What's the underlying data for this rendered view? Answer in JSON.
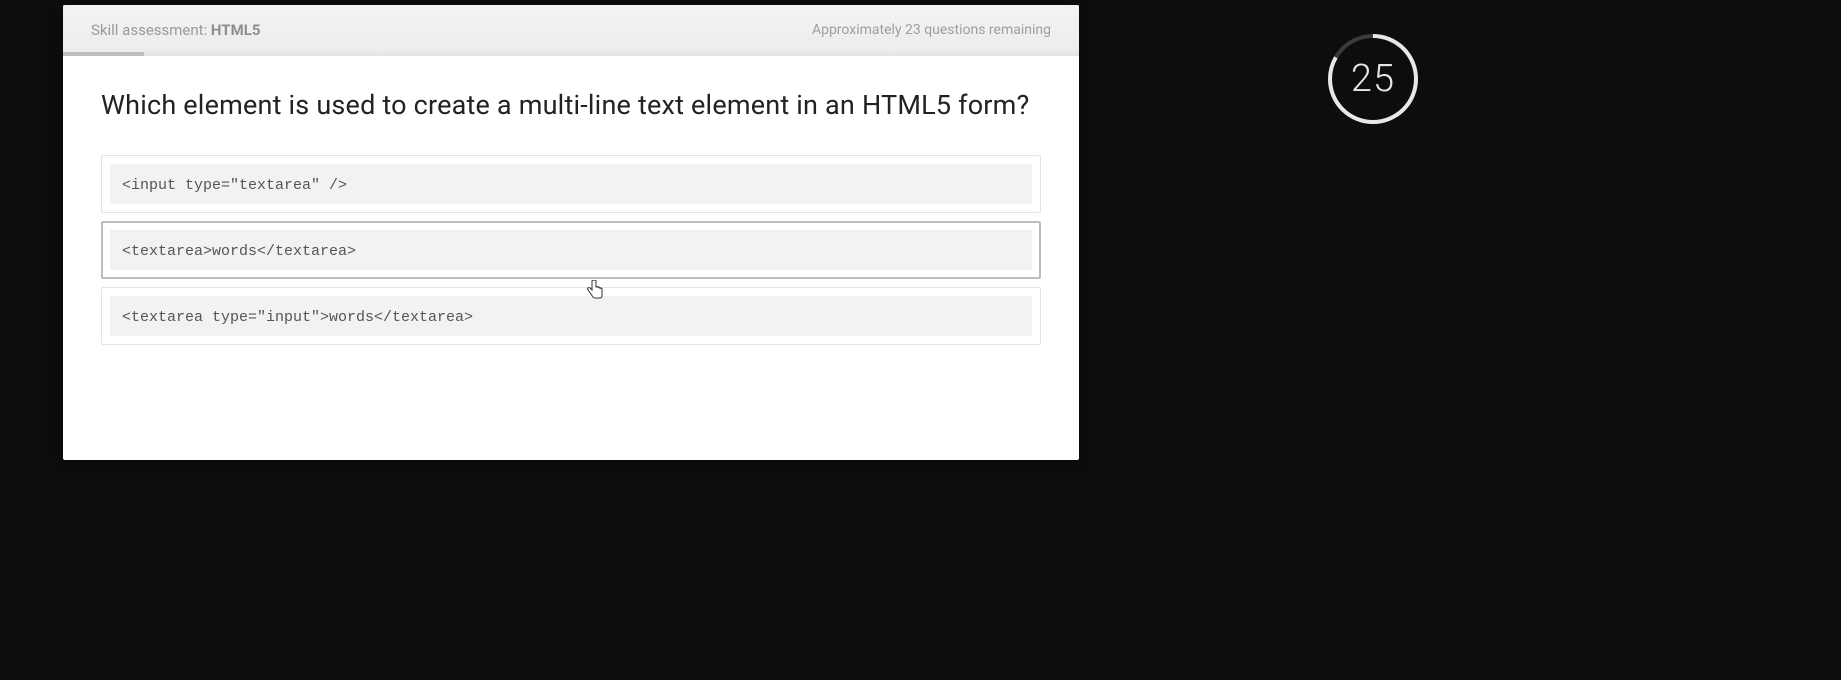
{
  "header": {
    "prefix": "Skill assessment: ",
    "topic": "HTML5",
    "remaining": "Approximately 23 questions remaining"
  },
  "question": "Which element is used to create a multi-line text element in an HTML5 form?",
  "options": [
    {
      "code": "<input type=\"textarea\" />",
      "selected": false
    },
    {
      "code": "<textarea>words</textarea>",
      "selected": true
    },
    {
      "code": "<textarea type=\"input\">words</textarea>",
      "selected": false
    }
  ],
  "timer": {
    "value": "25"
  },
  "progress": {
    "percent": 8
  }
}
